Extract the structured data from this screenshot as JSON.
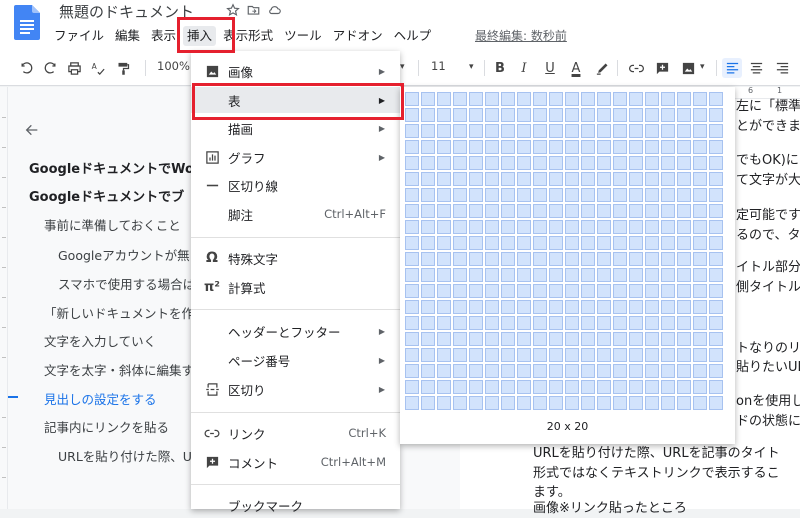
{
  "doc": {
    "title": "無題のドキュメント",
    "last_edit": "最終編集: 数秒前"
  },
  "menubar": {
    "items": [
      {
        "label": "ファイル"
      },
      {
        "label": "編集"
      },
      {
        "label": "表示"
      },
      {
        "label": "挿入"
      },
      {
        "label": "表示形式"
      },
      {
        "label": "ツール"
      },
      {
        "label": "アドオン"
      },
      {
        "label": "ヘルプ"
      }
    ],
    "active_index": 3
  },
  "toolbar": {
    "zoom": "100%",
    "font_size": "11",
    "bold": "B",
    "italic": "I",
    "underline": "U",
    "text_color": "A"
  },
  "outline": {
    "items": [
      {
        "label": "GoogleドキュメントでWo",
        "level": "h1"
      },
      {
        "label": "Googleドキュメントでブ",
        "level": "h1"
      },
      {
        "label": "事前に準備しておくこと",
        "level": "h2"
      },
      {
        "label": "Googleアカウントが無い",
        "level": "h3"
      },
      {
        "label": "スマホで使用する場合は",
        "level": "h3"
      },
      {
        "label": "「新しいドキュメントを作",
        "level": "h2"
      },
      {
        "label": "文字を入力していく",
        "level": "h2"
      },
      {
        "label": "文字を太字・斜体に編集す",
        "level": "h2"
      },
      {
        "label": "見出しの設定をする",
        "level": "h2",
        "active": true
      },
      {
        "label": "記事内にリンクを貼る",
        "level": "h2"
      },
      {
        "label": "URLを貼り付けた際、UR",
        "level": "h3"
      }
    ]
  },
  "insert_menu": {
    "items": [
      {
        "label": "画像",
        "icon": "image-icon",
        "submenu": true
      },
      {
        "label": "表",
        "icon": "",
        "submenu": true,
        "highlight": true
      },
      {
        "label": "描画",
        "icon": "",
        "submenu": true
      },
      {
        "label": "グラフ",
        "icon": "chart-icon",
        "submenu": true
      },
      {
        "label": "区切り線",
        "icon": "horizontal-line-icon",
        "submenu": false
      },
      {
        "label": "脚注",
        "icon": "",
        "shortcut": "Ctrl+Alt+F"
      },
      {
        "label": "特殊文字",
        "icon": "omega-icon",
        "submenu": false
      },
      {
        "label": "計算式",
        "icon": "pi-icon",
        "submenu": false
      },
      {
        "label": "ヘッダーとフッター",
        "icon": "",
        "submenu": true
      },
      {
        "label": "ページ番号",
        "icon": "",
        "submenu": true
      },
      {
        "label": "区切り",
        "icon": "page-break-icon",
        "submenu": true
      },
      {
        "label": "リンク",
        "icon": "link-icon",
        "shortcut": "Ctrl+K"
      },
      {
        "label": "コメント",
        "icon": "comment-icon",
        "shortcut": "Ctrl+Alt+M"
      },
      {
        "label": "ブックマーク",
        "icon": "",
        "submenu": false
      }
    ]
  },
  "table_grid": {
    "rows": 20,
    "cols": 20,
    "size_label": "20 x 20"
  },
  "document_text": {
    "lines": [
      "左に「標準",
      "とができま",
      "でもOK)に",
      "て文字が大",
      "定可能です",
      "るので、タ",
      "イトル部分",
      "側タイトル",
      "トなりのリ",
      "貼りたいUF",
      "onを使用し",
      "ドの状態に",
      "URLを貼り付けた際、URLを記事のタイト",
      "形式ではなくテキストリンクで表示するこ",
      "ます。",
      "画像※リンク貼ったところ"
    ]
  },
  "ruler": {
    "marks": [
      "6",
      "1"
    ]
  },
  "colors": {
    "highlight_box": "#e5202e",
    "grid_cell": "#d2e3fc",
    "accent": "#1a73e8"
  }
}
